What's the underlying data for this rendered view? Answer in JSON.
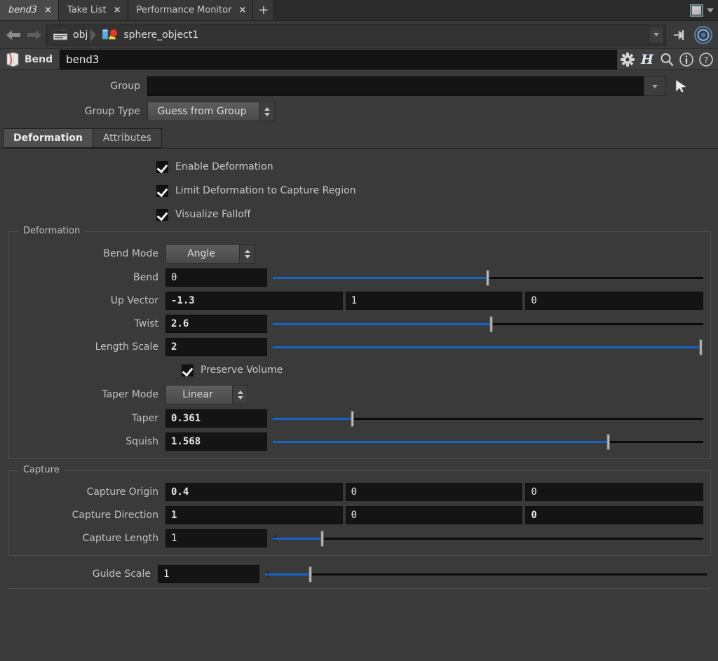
{
  "window": {
    "tabs": [
      {
        "label": "bend3",
        "active": true,
        "close": "×"
      },
      {
        "label": "Take List",
        "active": false,
        "close": "×"
      },
      {
        "label": "Performance Monitor",
        "active": false,
        "close": "×"
      }
    ],
    "add_tab_label": "+",
    "maximize_icon": "window-maximize-icon",
    "menu_caret_icon": "chevron-down-icon"
  },
  "pathbar": {
    "back_icon": "back-arrow-icon",
    "forward_icon": "forward-arrow-icon",
    "crumbs": [
      {
        "icon": "obj-network-icon",
        "label": "obj"
      },
      {
        "icon": "geometry-object-icon",
        "label": "sphere_object1"
      }
    ],
    "dropdown_icon": "chevron-down-icon",
    "pin_icon": "pin-icon",
    "target_icon": "target-icon"
  },
  "node_header": {
    "type_icon": "bend-sop-icon",
    "type_label": "Bend",
    "name_value": "bend3",
    "icons": [
      {
        "name": "gear-icon",
        "glyph": "✻"
      },
      {
        "name": "houdini-help-icon",
        "glyph": "H"
      },
      {
        "name": "search-icon",
        "glyph": ""
      },
      {
        "name": "info-icon",
        "glyph": "i"
      },
      {
        "name": "help-icon",
        "glyph": "?"
      }
    ]
  },
  "top_params": {
    "group": {
      "label": "Group",
      "value": "",
      "placeholder": "",
      "dropdown_icon": "chevron-down-icon"
    },
    "group_type": {
      "label": "Group Type",
      "value": "Guess from Group"
    },
    "pick_arrow_icon": "cursor-arrow-icon"
  },
  "parm_tabs": [
    {
      "label": "Deformation",
      "active": true
    },
    {
      "label": "Attributes",
      "active": false
    }
  ],
  "toggles": [
    {
      "label": "Enable Deformation",
      "checked": true
    },
    {
      "label": "Limit Deformation to Capture Region",
      "checked": true
    },
    {
      "label": "Visualize Falloff",
      "checked": true
    }
  ],
  "deformation_group": {
    "title": "Deformation",
    "bend_mode": {
      "label": "Bend Mode",
      "value": "Angle"
    },
    "bend": {
      "label": "Bend",
      "value": "0",
      "modified": false,
      "slider_pct": 50.0
    },
    "up_vector": {
      "label": "Up Vector",
      "values": [
        "-1.3",
        "1",
        "0"
      ],
      "modified": [
        true,
        false,
        false
      ]
    },
    "twist": {
      "label": "Twist",
      "value": "2.6",
      "modified": true,
      "slider_pct": 50.8
    },
    "length_scale": {
      "label": "Length Scale",
      "value": "2",
      "modified": true,
      "slider_pct": 99.5
    },
    "preserve_volume": {
      "label": "Preserve Volume",
      "checked": true
    },
    "taper_mode": {
      "label": "Taper Mode",
      "value": "Linear"
    },
    "taper": {
      "label": "Taper",
      "value": "0.361",
      "modified": true,
      "slider_pct": 18.6
    },
    "squish": {
      "label": "Squish",
      "value": "1.568",
      "modified": true,
      "slider_pct": 78.0
    }
  },
  "capture_group": {
    "title": "Capture",
    "capture_origin": {
      "label": "Capture Origin",
      "values": [
        "0.4",
        "0",
        "0"
      ],
      "modified": [
        true,
        false,
        false
      ]
    },
    "capture_direction": {
      "label": "Capture Direction",
      "values": [
        "1",
        "0",
        "0"
      ],
      "modified": [
        true,
        false,
        true
      ]
    },
    "capture_length": {
      "label": "Capture Length",
      "value": "1",
      "modified": false,
      "slider_pct": 11.5
    }
  },
  "guide_scale": {
    "label": "Guide Scale",
    "value": "1",
    "modified": false,
    "slider_pct": 10.3
  },
  "colors": {
    "background": "#3a3a3a",
    "field_bg": "#141414",
    "slider_fill": "#1565c8",
    "text": "#c8c8c8",
    "tab_active": "#4a4a4a"
  }
}
